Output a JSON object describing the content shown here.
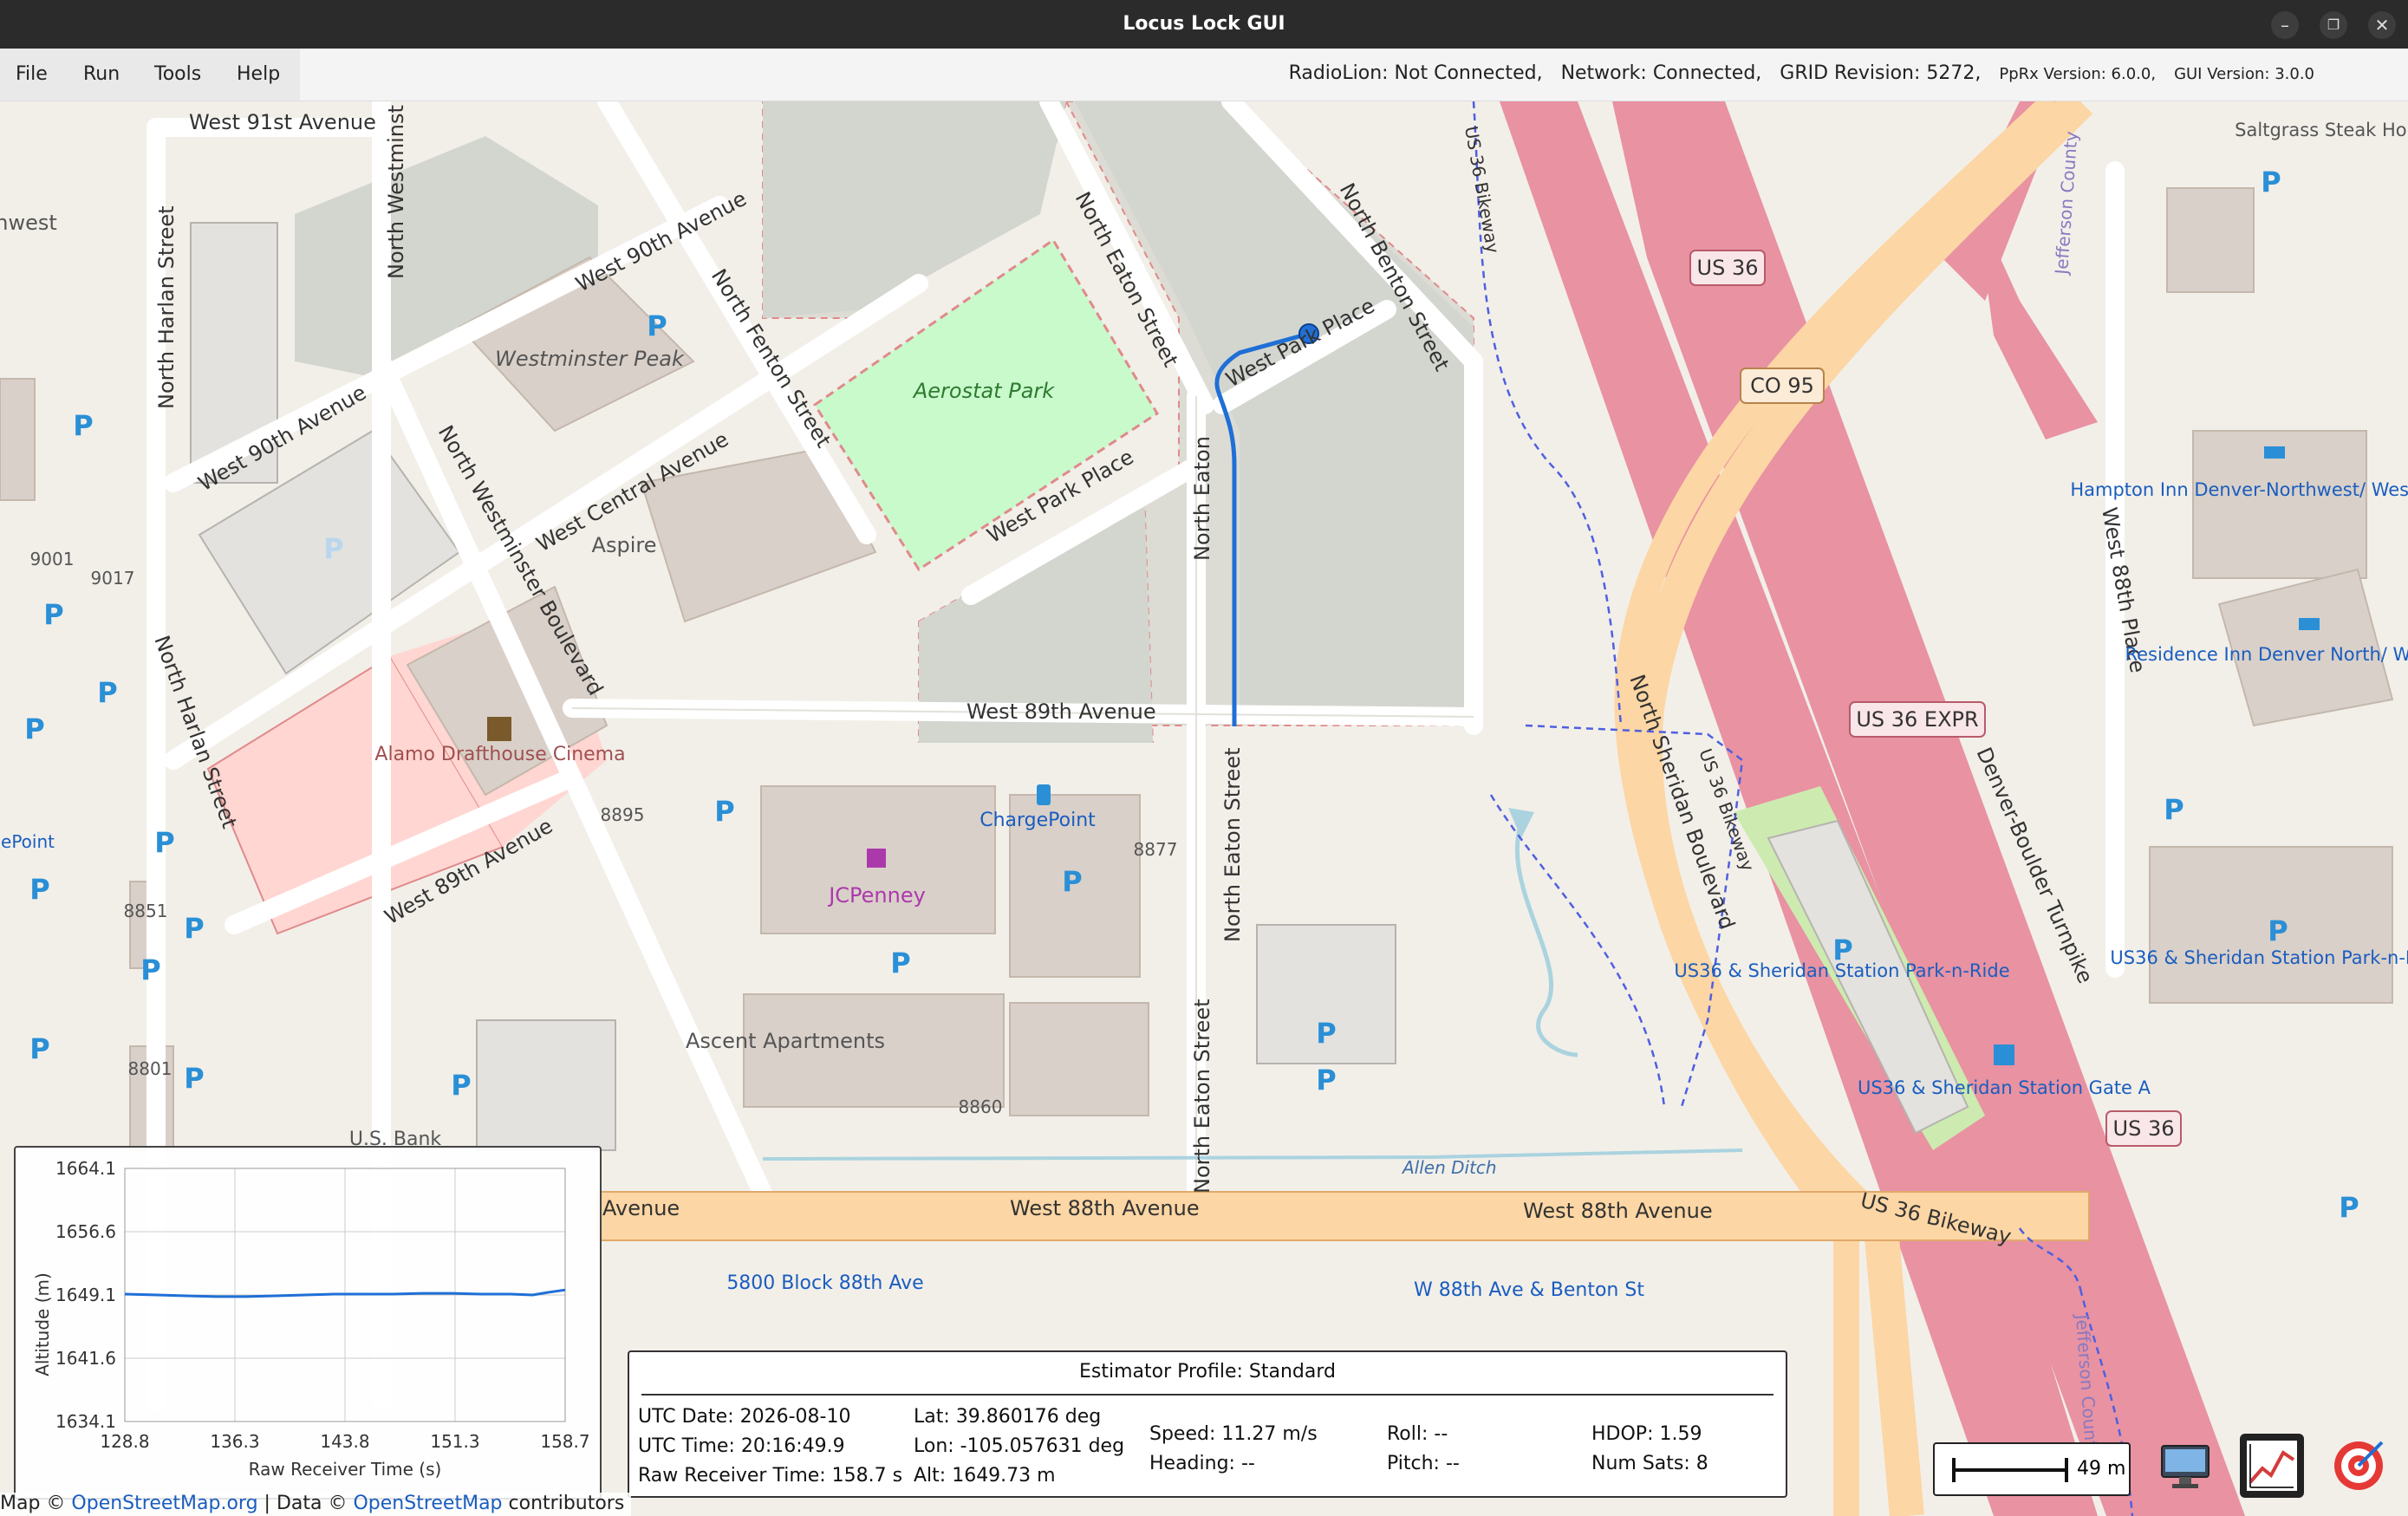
{
  "window": {
    "title": "Locus Lock GUI"
  },
  "menu": {
    "file": "File",
    "run": "Run",
    "tools": "Tools",
    "help": "Help"
  },
  "status": {
    "radiolion": "RadioLion: Not Connected,",
    "network": "Network: Connected,",
    "grid": "GRID Revision: 5272,",
    "pprx": "PpRx Version: 6.0.0,",
    "gui": "GUI Version: 3.0.0"
  },
  "map_labels": {
    "w91": "West 91st Avenue",
    "w90a": "West 90th Avenue",
    "w90b": "West 90th Avenue",
    "w_central": "West Central Avenue",
    "w_park1": "West Park Place",
    "w_park2": "West Park Place",
    "w89": "West 89th Avenue",
    "w89b": "West 89th Avenue",
    "w88a": "West 88th Avenue",
    "w88b": "West 88th Avenue",
    "w88c": "Avenue",
    "n_harlan1": "North Harlan Street",
    "n_harlan2": "North Harlan Street",
    "n_westminster": "North Westminster Boulevard",
    "n_westminster_top": "North Westminst",
    "n_fenton": "North Fenton Street",
    "n_eaton1": "North Eaton Street",
    "n_eaton2": "North Eaton",
    "n_eaton3": "North Eaton Street",
    "n_eaton4": "North Eaton Street",
    "n_benton": "North Benton Street",
    "n_sheridan": "North Sheridan Boulevard",
    "w88_place": "West 88th Place",
    "denver_boulder": "Denver-Boulder Turnpike",
    "us36_bikeway1": "US 36 Bikeway",
    "us36_bikeway2": "US 36 Bikeway",
    "us36_bikeway3": "US 36 Bikeway",
    "jefferson1": "Jefferson County",
    "jefferson2": "Jefferson Count",
    "allen_ditch": "Allen Ditch",
    "westminster_peak": "Westminster Peak",
    "aerostat": "Aerostat Park",
    "aspire": "Aspire",
    "alamo": "Alamo Drafthouse Cinema",
    "jcpenney": "JCPenney",
    "chargepoint": "ChargePoint",
    "ascent": "Ascent Apartments",
    "usbank": "U.S. Bank",
    "stop_5800": "5800 Block 88th Ave",
    "stop_w88": "W 88th Ave & Benton St",
    "parkride1": "US36 & Sheridan Station Park-n-Ride",
    "parkride2": "US36 & Sheridan Station Park-n-Ride",
    "gate_a": "US36 & Sheridan Station Gate A",
    "hampton": "Hampton Inn Denver-Northwest/ Westminster",
    "residence": "Residence Inn Denver North/ Westminster",
    "saltgrass": "Saltgrass Steak House",
    "shield_us36_1": "US 36",
    "shield_us36_2": "US 36",
    "shield_co95": "CO 95",
    "shield_expr": "US 36 EXPR",
    "addr_9001": "9001",
    "addr_9017": "9017",
    "addr_8895": "8895",
    "addr_8877": "8877",
    "addr_8851": "8851",
    "addr_8801": "8801",
    "addr_8860": "8860",
    "edge_point": "ePoint",
    "edge_west": "hwest"
  },
  "plot": {
    "ylabel": "Altitude (m)",
    "xlabel": "Raw Receiver Time (s)",
    "yticks": [
      "1664.1",
      "1656.6",
      "1649.1",
      "1641.6",
      "1634.1"
    ],
    "xticks": [
      "128.8",
      "136.3",
      "143.8",
      "151.3",
      "158.7"
    ],
    "line_color": "#1f6fd6"
  },
  "chart_data": {
    "type": "line",
    "xlabel": "Raw Receiver Time (s)",
    "ylabel": "Altitude (m)",
    "xlim": [
      128.8,
      158.7
    ],
    "ylim": [
      1634.1,
      1664.1
    ],
    "grid": true,
    "series": [
      {
        "x": [
          128.8,
          131,
          133,
          135,
          137,
          139,
          141,
          143,
          145,
          147,
          149,
          151,
          153,
          155,
          156.5,
          157.5,
          158.7
        ],
        "values": [
          1649.2,
          1649.1,
          1649.0,
          1648.9,
          1648.9,
          1649.0,
          1649.1,
          1649.2,
          1649.2,
          1649.2,
          1649.3,
          1649.3,
          1649.2,
          1649.2,
          1649.1,
          1649.4,
          1649.7
        ]
      }
    ]
  },
  "estimator": {
    "profile": "Estimator Profile: Standard",
    "utc_date": "UTC Date: 2026-08-10",
    "utc_time": "UTC Time: 20:16:49.9",
    "raw_time": "Raw Receiver Time: 158.7 s",
    "lat": "Lat: 39.860176 deg",
    "lon": "Lon: -105.057631 deg",
    "alt": "Alt: 1649.73 m",
    "speed": "Speed: 11.27 m/s",
    "heading": "Heading: --",
    "roll": "Roll: --",
    "pitch": "Pitch: --",
    "hdop": "HDOP: 1.59",
    "num_sats": "Num Sats: 8"
  },
  "scale": {
    "label": "49 m"
  },
  "attribution": {
    "map": "Map ©",
    "osm": "OpenStreetMap.org",
    "data": "| Data ©",
    "osm2": "OpenStreetMap",
    "contributors": "contributors"
  },
  "colors": {
    "trajectory": "#1f6fd6",
    "motorway": "#e892a2",
    "primary": "#fcd6a4",
    "park": "#c8facc",
    "building": "#d9d0c9",
    "background": "#f2efe9"
  },
  "icons": {
    "monitor": "monitor-icon",
    "chart": "chart-icon",
    "target": "target-icon"
  }
}
